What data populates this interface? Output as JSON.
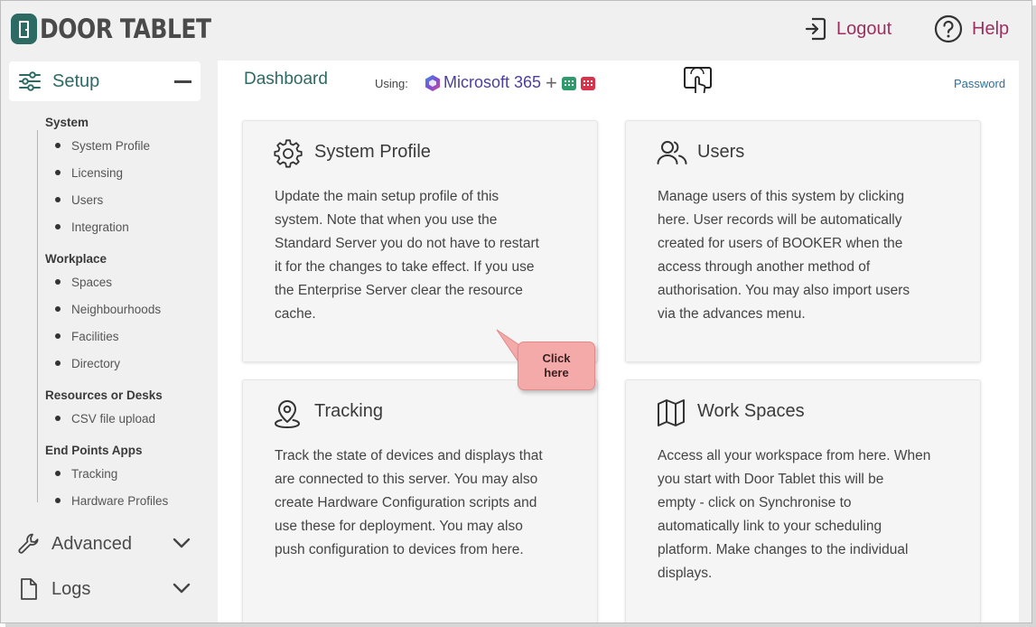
{
  "header": {
    "logo_text": "DOOR TABLET",
    "logout_label": "Logout",
    "help_label": "Help"
  },
  "sidebar": {
    "setup_label": "Setup",
    "groups": [
      {
        "title": "System",
        "items": [
          "System Profile",
          "Licensing",
          "Users",
          "Integration"
        ]
      },
      {
        "title": "Workplace",
        "items": [
          "Spaces",
          "Neighbourhoods",
          "Facilities",
          "Directory"
        ]
      },
      {
        "title": "Resources or Desks",
        "items": [
          "CSV file upload"
        ]
      },
      {
        "title": "End Points Apps",
        "items": [
          "Tracking",
          "Hardware Profiles"
        ]
      }
    ],
    "advanced_label": "Advanced",
    "logs_label": "Logs"
  },
  "main": {
    "title": "Dashboard",
    "using_label": "Using:",
    "ms365_label": "Microsoft 365",
    "password_link": "Password",
    "cards": [
      {
        "title": "System Profile",
        "icon": "gear-icon",
        "lines": [
          "Update the main setup profile of this",
          "system. Note that when you use the",
          "Standard Server you do not have to restart",
          "it for the changes to take effect. If you use",
          "the Enterprise Server clear the resource",
          "cache."
        ]
      },
      {
        "title": "Users",
        "icon": "users-icon",
        "lines": [
          "Manage users of this system by clicking",
          "here. User records will be automatically",
          "created for users of BOOKER when the",
          "access through another method of",
          "authorisation. You may also import users",
          "via the advances menu."
        ]
      },
      {
        "title": "Tracking",
        "icon": "location-pin-icon",
        "lines": [
          "Track the state of devices and displays that",
          "are connected to this server. You may also",
          "create Hardware Configuration scripts and",
          "use these for deployment. You may also",
          "push configuration to devices from here."
        ]
      },
      {
        "title": "Work Spaces",
        "icon": "map-icon",
        "lines": [
          "Access all your workspace from here. When",
          "you start with Door Tablet this will be",
          "empty - click on Synchronise to",
          "automatically link to your scheduling",
          "platform. Make changes to the individual",
          "displays."
        ]
      }
    ]
  },
  "callout": {
    "line1": "Click",
    "line2": "here"
  },
  "colors": {
    "brand_green": "#2d6a63",
    "accent": "#9c2f5f",
    "callout": "#f5aaaa"
  }
}
